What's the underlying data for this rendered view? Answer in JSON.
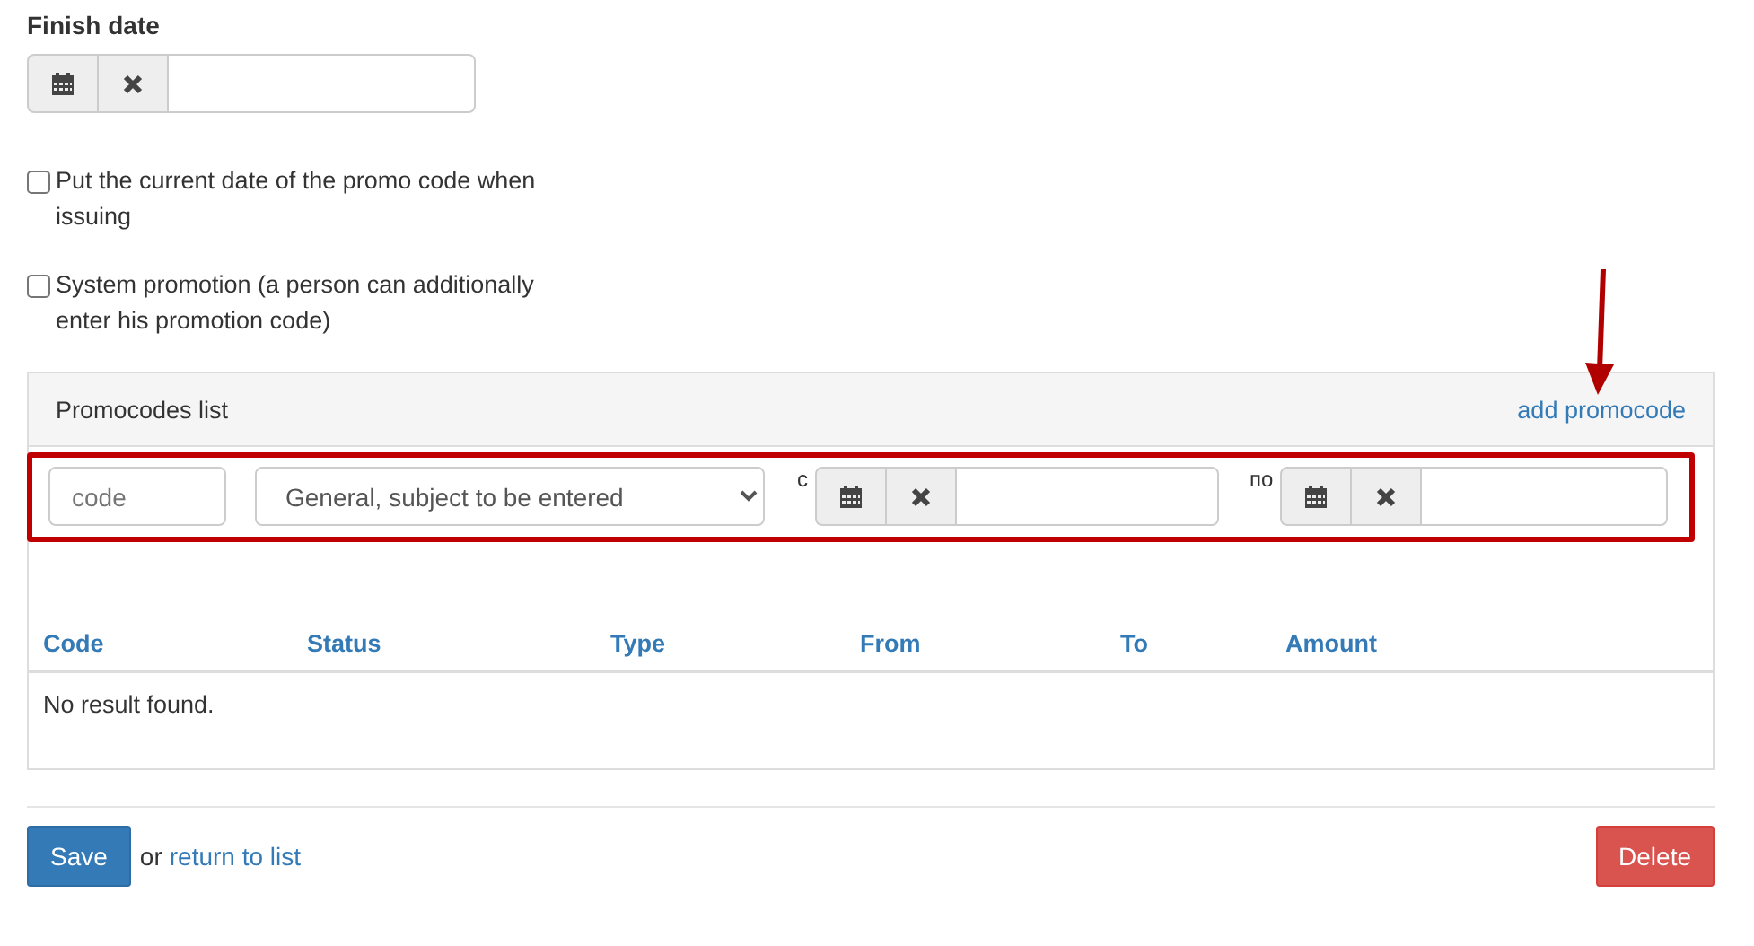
{
  "finish_date": {
    "label": "Finish date"
  },
  "checkboxes": [
    {
      "label": "Put the current date of the promo code when issuing",
      "checked": false
    },
    {
      "label": "System promotion (a person can additionally enter his promotion code)",
      "checked": false
    }
  ],
  "promocodes": {
    "title": "Promocodes list",
    "add_link": "add promocode",
    "filter": {
      "code_placeholder": "code",
      "type_value": "General, subject to be entered",
      "from_label": "с",
      "to_label": "по"
    },
    "columns": [
      "Code",
      "Status",
      "Type",
      "From",
      "To",
      "Amount"
    ],
    "empty_text": "No result found."
  },
  "footer": {
    "save": "Save",
    "or": "or",
    "return_link": "return to list",
    "delete": "Delete"
  }
}
